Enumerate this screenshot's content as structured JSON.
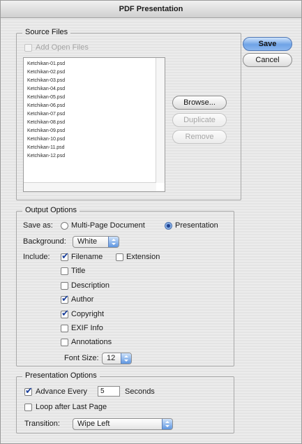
{
  "window": {
    "title": "PDF Presentation"
  },
  "buttons": {
    "save": "Save",
    "cancel": "Cancel",
    "browse": "Browse...",
    "duplicate": "Duplicate",
    "remove": "Remove"
  },
  "source_files": {
    "legend": "Source Files",
    "add_open_files": {
      "label": "Add Open Files",
      "checked": false,
      "enabled": false
    },
    "files": [
      "Ketchikan-01.psd",
      "Ketchikan-02.psd",
      "Ketchikan-03.psd",
      "Ketchikan-04.psd",
      "Ketchikan-05.psd",
      "Ketchikan-06.psd",
      "Ketchikan-07.psd",
      "Ketchikan-08.psd",
      "Ketchikan-09.psd",
      "Ketchikan-10.psd",
      "Ketchikan-11.psd",
      "Ketchikan-12.psd"
    ]
  },
  "output_options": {
    "legend": "Output Options",
    "save_as_label": "Save as:",
    "save_as_options": [
      "Multi-Page Document",
      "Presentation"
    ],
    "save_as_selected": "Presentation",
    "background_label": "Background:",
    "background_value": "White",
    "include_label": "Include:",
    "include": {
      "filename": {
        "label": "Filename",
        "checked": true
      },
      "extension": {
        "label": "Extension",
        "checked": false
      },
      "title": {
        "label": "Title",
        "checked": false
      },
      "description": {
        "label": "Description",
        "checked": false
      },
      "author": {
        "label": "Author",
        "checked": true
      },
      "copyright": {
        "label": "Copyright",
        "checked": true
      },
      "exif": {
        "label": "EXIF Info",
        "checked": false
      },
      "annotations": {
        "label": "Annotations",
        "checked": false
      }
    },
    "font_size_label": "Font Size:",
    "font_size_value": "12"
  },
  "presentation_options": {
    "legend": "Presentation Options",
    "advance_label": "Advance Every",
    "advance_checked": true,
    "advance_value": "5",
    "seconds_label": "Seconds",
    "loop_label": "Loop after Last Page",
    "loop_checked": false,
    "transition_label": "Transition:",
    "transition_value": "Wipe Left"
  },
  "colors": {
    "accent": "#6fa3e6",
    "window_bg": "#ececec",
    "check_mark": "#1b3f9a"
  }
}
